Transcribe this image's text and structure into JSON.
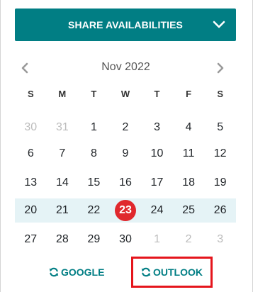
{
  "share": {
    "label": "SHARE AVAILABILITIES",
    "icon": "chevron-down-icon"
  },
  "calendar": {
    "month_label": "Nov 2022",
    "prev_icon": "chevron-left-icon",
    "next_icon": "chevron-right-icon",
    "weekdays": [
      "S",
      "M",
      "T",
      "W",
      "T",
      "F",
      "S"
    ],
    "weeks": [
      [
        "30",
        "31",
        "1",
        "2",
        "3",
        "4",
        "5"
      ],
      [
        "6",
        "7",
        "8",
        "9",
        "10",
        "11",
        "12"
      ],
      [
        "13",
        "14",
        "15",
        "16",
        "17",
        "18",
        "19"
      ],
      [
        "20",
        "21",
        "22",
        "23",
        "24",
        "25",
        "26"
      ],
      [
        "27",
        "28",
        "29",
        "30",
        "1",
        "2",
        "3"
      ]
    ],
    "today": "23"
  },
  "sync": {
    "google_label": "GOOGLE",
    "outlook_label": "OUTLOOK",
    "icon": "refresh-icon"
  },
  "colors": {
    "accent": "#017e84",
    "today": "#e0282d",
    "current_week_bg": "#e5f3f6",
    "highlight": "#e5151c"
  }
}
